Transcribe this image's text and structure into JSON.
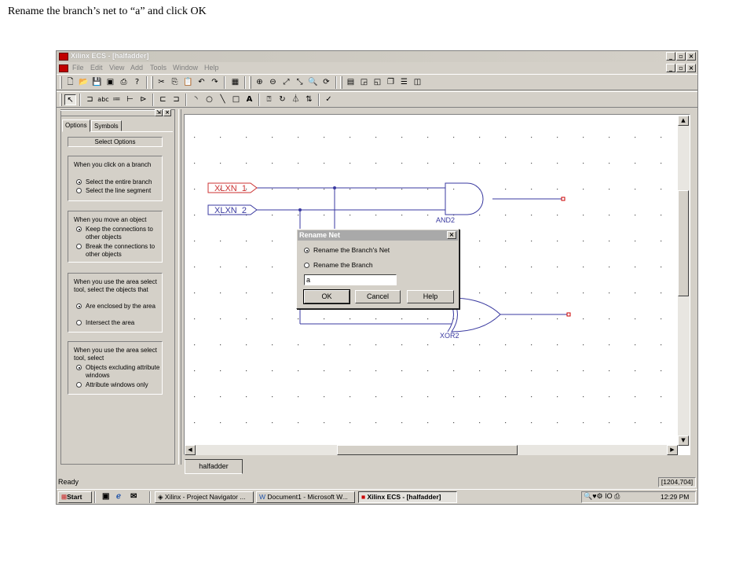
{
  "caption": "Rename the branch’s net to “a” and click OK",
  "window": {
    "title": "Xilinx ECS - [halfadder]",
    "controls": {
      "minimize": "_",
      "restore": "̱̲❐",
      "close": "×"
    },
    "menu": [
      "File",
      "Edit",
      "View",
      "Add",
      "Tools",
      "Window",
      "Help"
    ]
  },
  "sidepanel": {
    "tabs": [
      "Options",
      "Symbols"
    ],
    "header": "Select Options",
    "groups": [
      {
        "question": "When you click on a branch",
        "options": [
          {
            "label": "Select the entire branch",
            "selected": true
          },
          {
            "label": "Select the line segment",
            "selected": false
          }
        ]
      },
      {
        "question": "When you move an object",
        "options": [
          {
            "label": "Keep the connections to other objects",
            "selected": true
          },
          {
            "label": "Break the connections to other objects",
            "selected": false
          }
        ]
      },
      {
        "question": "When you use the area select tool, select the objects that",
        "options": [
          {
            "label": "Are enclosed by the area",
            "selected": true
          },
          {
            "label": "Intersect the area",
            "selected": false
          }
        ]
      },
      {
        "question": "When you use the area select tool, select",
        "options": [
          {
            "label": "Objects excluding attribute windows",
            "selected": true
          },
          {
            "label": "Attribute windows only",
            "selected": false
          }
        ]
      }
    ]
  },
  "schematic": {
    "input_ports": [
      "XLXN_1",
      "XLXN_2"
    ],
    "gates": [
      "AND2",
      "XOR2"
    ]
  },
  "dialog": {
    "title": "Rename Net",
    "options": [
      {
        "label": "Rename the Branch's Net",
        "selected": true
      },
      {
        "label": "Rename the Branch",
        "selected": false
      }
    ],
    "input_value": "a",
    "buttons": [
      "OK",
      "Cancel",
      "Help"
    ]
  },
  "doc_tab": "halfadder",
  "status": {
    "left": "Ready",
    "coords": "[1204,704]"
  },
  "taskbar": {
    "start": "Start",
    "items": [
      {
        "label": "Xilinx - Project Navigator ...",
        "active": false
      },
      {
        "label": "Document1 - Microsoft W...",
        "active": false
      },
      {
        "label": "Xilinx ECS - [halfadder]",
        "active": true
      }
    ],
    "clock": "12:29 PM"
  },
  "colors": {
    "wire": "#3a3aa0",
    "port_red": "#cc3333",
    "port_blue": "#3a3aa0",
    "marker": "#cc0000"
  }
}
